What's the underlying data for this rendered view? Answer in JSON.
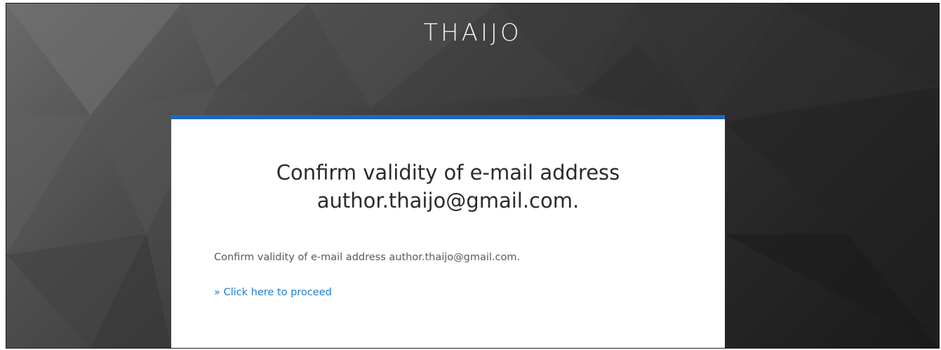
{
  "brand": {
    "name": "THAIJO"
  },
  "card": {
    "title_line1": "Confirm validity of e-mail address",
    "title_line2": "author.thaijo@gmail.com.",
    "message": "Confirm validity of e-mail address author.thaijo@gmail.com.",
    "proceed_link": "» Click here to proceed"
  },
  "colors": {
    "accent_bar": "#1b67c4",
    "link": "#1a7fd4",
    "background_dark": "#2a2a2a"
  }
}
